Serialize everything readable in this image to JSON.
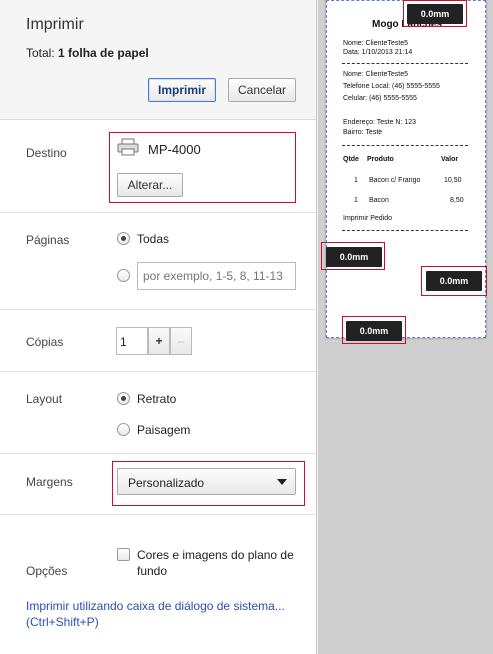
{
  "header": {
    "title": "Imprimir",
    "total_prefix": "Total:",
    "total_value": "1 folha de papel",
    "print_label": "Imprimir",
    "cancel_label": "Cancelar"
  },
  "destination": {
    "label": "Destino",
    "printer_name": "MP-4000",
    "change_label": "Alterar..."
  },
  "pages": {
    "label": "Páginas",
    "all_label": "Todas",
    "all_selected": true,
    "range_placeholder": "por exemplo, 1-5, 8, 11-13"
  },
  "copies": {
    "label": "Cópias",
    "value": "1",
    "plus": "+",
    "minus": "–"
  },
  "layout": {
    "label": "Layout",
    "portrait": "Retrato",
    "landscape": "Paisagem",
    "selected": "portrait"
  },
  "margins": {
    "label": "Margens",
    "selected": "Personalizado"
  },
  "options": {
    "label": "Opções",
    "background_label": "Cores e imagens do plano de fundo",
    "checked": false
  },
  "system_dialog_link": "Imprimir utilizando caixa de diálogo de sistema... (Ctrl+Shift+P)",
  "preview": {
    "margin_top": "0.0mm",
    "margin_left": "0.0mm",
    "margin_right": "0.0mm",
    "margin_bottom": "0.0mm",
    "receipt": {
      "title": "Mogo Lanches",
      "nome1": "Nome: ClienteTeste5",
      "data": "Data: 1/10/2013 21:14",
      "nome2": "Nome: ClienteTeste5",
      "tel": "Telefone Local: (46) 5555-5555",
      "cel": "Celular: (46) 5555-5555",
      "endereco": "Endereço: Teste N: 123",
      "bairro": "Bairro: Teste",
      "col_qtde": "Qtde",
      "col_produto": "Produto",
      "col_valor": "Valor",
      "items": [
        {
          "qtde": "1",
          "produto": "Bacon c/ Frango",
          "valor": "10,50"
        },
        {
          "qtde": "1",
          "produto": "Bacon",
          "valor": "8,50"
        }
      ],
      "footer": "Imprimir Pedido"
    }
  },
  "colors": {
    "highlight": "#c8102e",
    "link": "#2a4fb0",
    "marker": "#222222"
  }
}
